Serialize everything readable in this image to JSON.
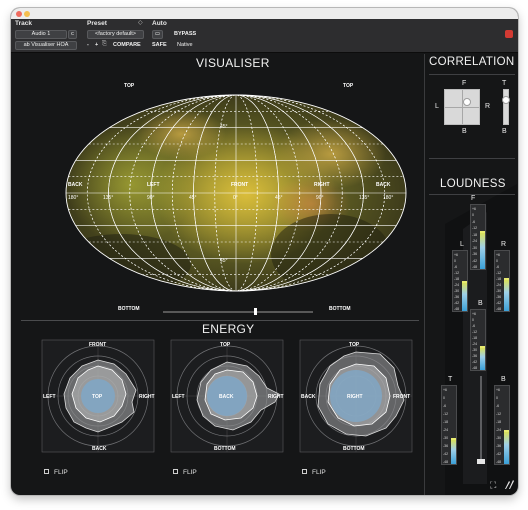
{
  "header": {
    "track_label": "Track",
    "preset_label": "Preset",
    "auto_label": "Auto",
    "track_name": "Audio 1",
    "track_sel": "c",
    "preset_name": "<factory default>",
    "compare_label": "COMPARE",
    "plugin_name": "ab Visualiser HOA",
    "minus": "-",
    "plus": "+",
    "safe_label": "SAFE",
    "bypass_label": "BYPASS",
    "native_label": "Native"
  },
  "visualiser": {
    "title": "VISUALISER",
    "top_left": "TOP",
    "top_right": "TOP",
    "bottom_left": "BOTTOM",
    "bottom_right": "BOTTOM",
    "back_left": "BACK",
    "left": "LEFT",
    "front": "FRONT",
    "right": "RIGHT",
    "back_right": "BACK",
    "lon_labels": [
      "180°",
      "135°",
      "90°",
      "45°",
      "0°",
      "45°",
      "90°",
      "135°",
      "180°"
    ],
    "lat_top": "45°",
    "lat_bottom": "45°"
  },
  "energy": {
    "title": "ENERGY",
    "plots": [
      {
        "top": "FRONT",
        "left": "LEFT",
        "right": "RIGHT",
        "bottom": "BACK",
        "center": "TOP"
      },
      {
        "top": "TOP",
        "left": "LEFT",
        "right": "RIGHT",
        "bottom": "BOTTOM",
        "center": "BACK"
      },
      {
        "top": "TOP",
        "left": "BACK",
        "right": "FRONT",
        "bottom": "BOTTOM",
        "center": "RIGHT"
      }
    ],
    "flip_label": "FLIP"
  },
  "correlation": {
    "title": "CORRELATION",
    "f": "F",
    "l": "L",
    "r": "R",
    "b": "B",
    "t": "T",
    "b2": "B"
  },
  "loudness": {
    "title": "LOUDNESS",
    "channels": [
      "F",
      "L",
      "R",
      "B",
      "T",
      "B"
    ],
    "scale": [
      "+6",
      "0",
      "-6",
      "-12",
      "-18",
      "-24",
      "-30",
      "-36",
      "-42",
      "-48"
    ],
    "levels": [
      0.55,
      0.45,
      0.5,
      0.35,
      0.3,
      0.4
    ]
  },
  "colors": {
    "accent": "#3aa0d8",
    "meter_yellow": "#d9e15a",
    "heat": "#e0c23a"
  }
}
